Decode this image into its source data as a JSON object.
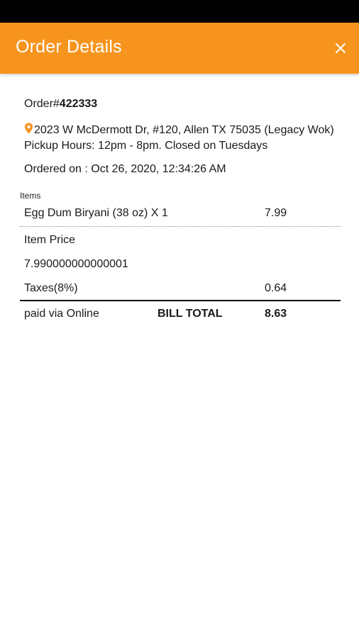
{
  "header": {
    "title": "Order Details",
    "close_icon": "close-icon",
    "color": "#f7941d"
  },
  "order": {
    "number_prefix": "Order#",
    "number": "422333",
    "location_icon": "map-pin-icon",
    "address": "2023 W McDermott Dr, #120, Allen TX 75035 (Legacy Wok) Pickup Hours: 12pm - 8pm. Closed on Tuesdays",
    "ordered_on": "Ordered on : Oct 26, 2020, 12:34:26 AM"
  },
  "items": {
    "label": "Items",
    "list": [
      {
        "name": "Egg Dum Biryani (38 oz) X 1",
        "price": "7.99"
      }
    ]
  },
  "summary": {
    "item_price_label": "Item Price",
    "item_price_value": "7.990000000000001",
    "tax_label": "Taxes(8%)",
    "tax_value": "0.64",
    "payment": "paid via Online",
    "bill_total_label": "BILL TOTAL",
    "bill_total_value": "8.63"
  }
}
